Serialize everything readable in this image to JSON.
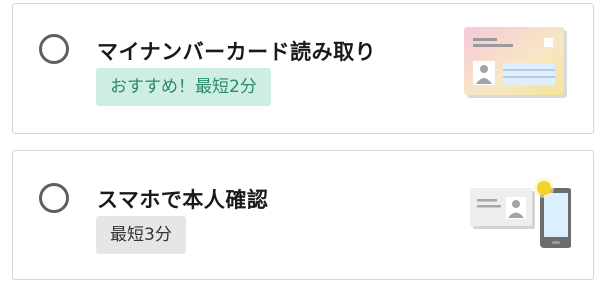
{
  "options": [
    {
      "title": "マイナンバーカード読み取り",
      "badge": "おすすめ！最短2分",
      "icon": "my-number-card-icon",
      "selected": false
    },
    {
      "title": "スマホで本人確認",
      "badge": "最短3分",
      "icon": "smartphone-id-icon",
      "selected": false
    }
  ],
  "colors": {
    "recommend_badge_bg": "#cfeee3",
    "recommend_badge_text": "#2a8a6a",
    "neutral_badge_bg": "#e6e6e6",
    "card_border": "#d6d6d6",
    "radio_border": "#5f5f5f"
  }
}
